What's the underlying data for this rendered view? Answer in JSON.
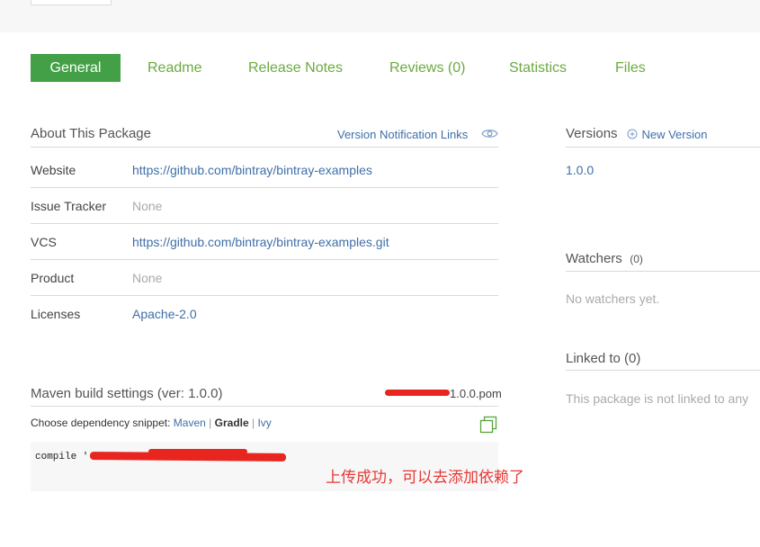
{
  "tabs": [
    {
      "label": "General",
      "active": true
    },
    {
      "label": "Readme"
    },
    {
      "label": "Release Notes"
    },
    {
      "label": "Reviews (0)"
    },
    {
      "label": "Statistics"
    },
    {
      "label": "Files"
    }
  ],
  "about": {
    "title": "About This Package",
    "notification_link": "Version Notification Links",
    "rows": [
      {
        "label": "Website",
        "value": "https://github.com/bintray/bintray-examples"
      },
      {
        "label": "Issue Tracker",
        "value": "None"
      },
      {
        "label": "VCS",
        "value": "https://github.com/bintray/bintray-examples.git"
      },
      {
        "label": "Product",
        "value": "None"
      },
      {
        "label": "Licenses",
        "value": "Apache-2.0"
      }
    ]
  },
  "maven": {
    "title": "Maven build settings (ver: 1.0.0)",
    "pom": "1.0.0.pom",
    "snippet_prefix": "Choose dependency snippet:",
    "options": [
      "Maven",
      "Gradle",
      "Ivy"
    ],
    "separator": "|",
    "selected": "Gradle",
    "code": "compile '"
  },
  "versions": {
    "title": "Versions",
    "new_version": "New Version",
    "items": [
      "1.0.0"
    ]
  },
  "watchers": {
    "title": "Watchers",
    "count": "(0)",
    "empty": "No watchers yet."
  },
  "linked": {
    "title": "Linked to (0)",
    "empty": "This package is not linked to any"
  },
  "annotation": "上传成功，可以去添加依赖了",
  "colors": {
    "accent": "#43a047",
    "link": "#3f6fa8",
    "annotation_red": "#e53935"
  }
}
